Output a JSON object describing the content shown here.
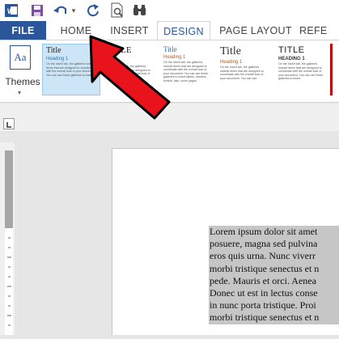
{
  "quick_access": {
    "icons": [
      "word-icon",
      "save-icon",
      "undo-icon",
      "redo-icon",
      "print-preview-icon",
      "find-icon"
    ],
    "dropdown": "▾"
  },
  "tabs": [
    {
      "label": "FILE"
    },
    {
      "label": "HOME"
    },
    {
      "label": "INSERT"
    },
    {
      "label": "DESIGN"
    },
    {
      "label": "PAGE LAYOUT"
    },
    {
      "label": "REFE"
    }
  ],
  "themes": {
    "label": "Themes",
    "icon_text": "Aa"
  },
  "style_gallery": [
    {
      "title": "Title",
      "heading": "Heading 1",
      "body": "On the Insert tab, the galleries include items that are designed to coordinate with the overall look of your document. You can use these galleries to insert"
    },
    {
      "title": "TITLE",
      "heading": "",
      "body": "On the Insert tab, the galleries include items that are designed to coordinate with the overall look of your document."
    },
    {
      "title": "Title",
      "heading": "Heading 1",
      "body": "On the Insert tab, the galleries include items that are designed to coordinate with the overall look of your document. You can use these galleries to insert tables, headers, footers, lists, cover pages."
    },
    {
      "title": "Title",
      "heading": "Heading 1",
      "body": "On the Insert tab, the galleries include items that are designed to coordinate with the overall look of your document. You can use"
    },
    {
      "title": "TITLE",
      "heading": "HEADING 1",
      "body": "On the Insert tab, the galleries include items that are designed to coordinate with the overall look of your document. You can use these galleries to insert"
    },
    {
      "title": "",
      "heading": "",
      "body": ""
    }
  ],
  "document": {
    "lines": [
      "Lorem ipsum dolor sit amet",
      "posuere, magna sed pulvina",
      "eros quis urna. Nunc viverr",
      "morbi tristique senectus et n",
      "pede. Mauris et orci. Aenea",
      "Donec ut est in lectus conse",
      "in nunc porta tristique. Proi",
      "morbi tristique senectus et n"
    ]
  },
  "annotation": {
    "arrow_color": "#e8131b",
    "arrow_outline": "#000000"
  },
  "colors": {
    "file_tab": "#2b579a",
    "accent": "#2b579a"
  }
}
